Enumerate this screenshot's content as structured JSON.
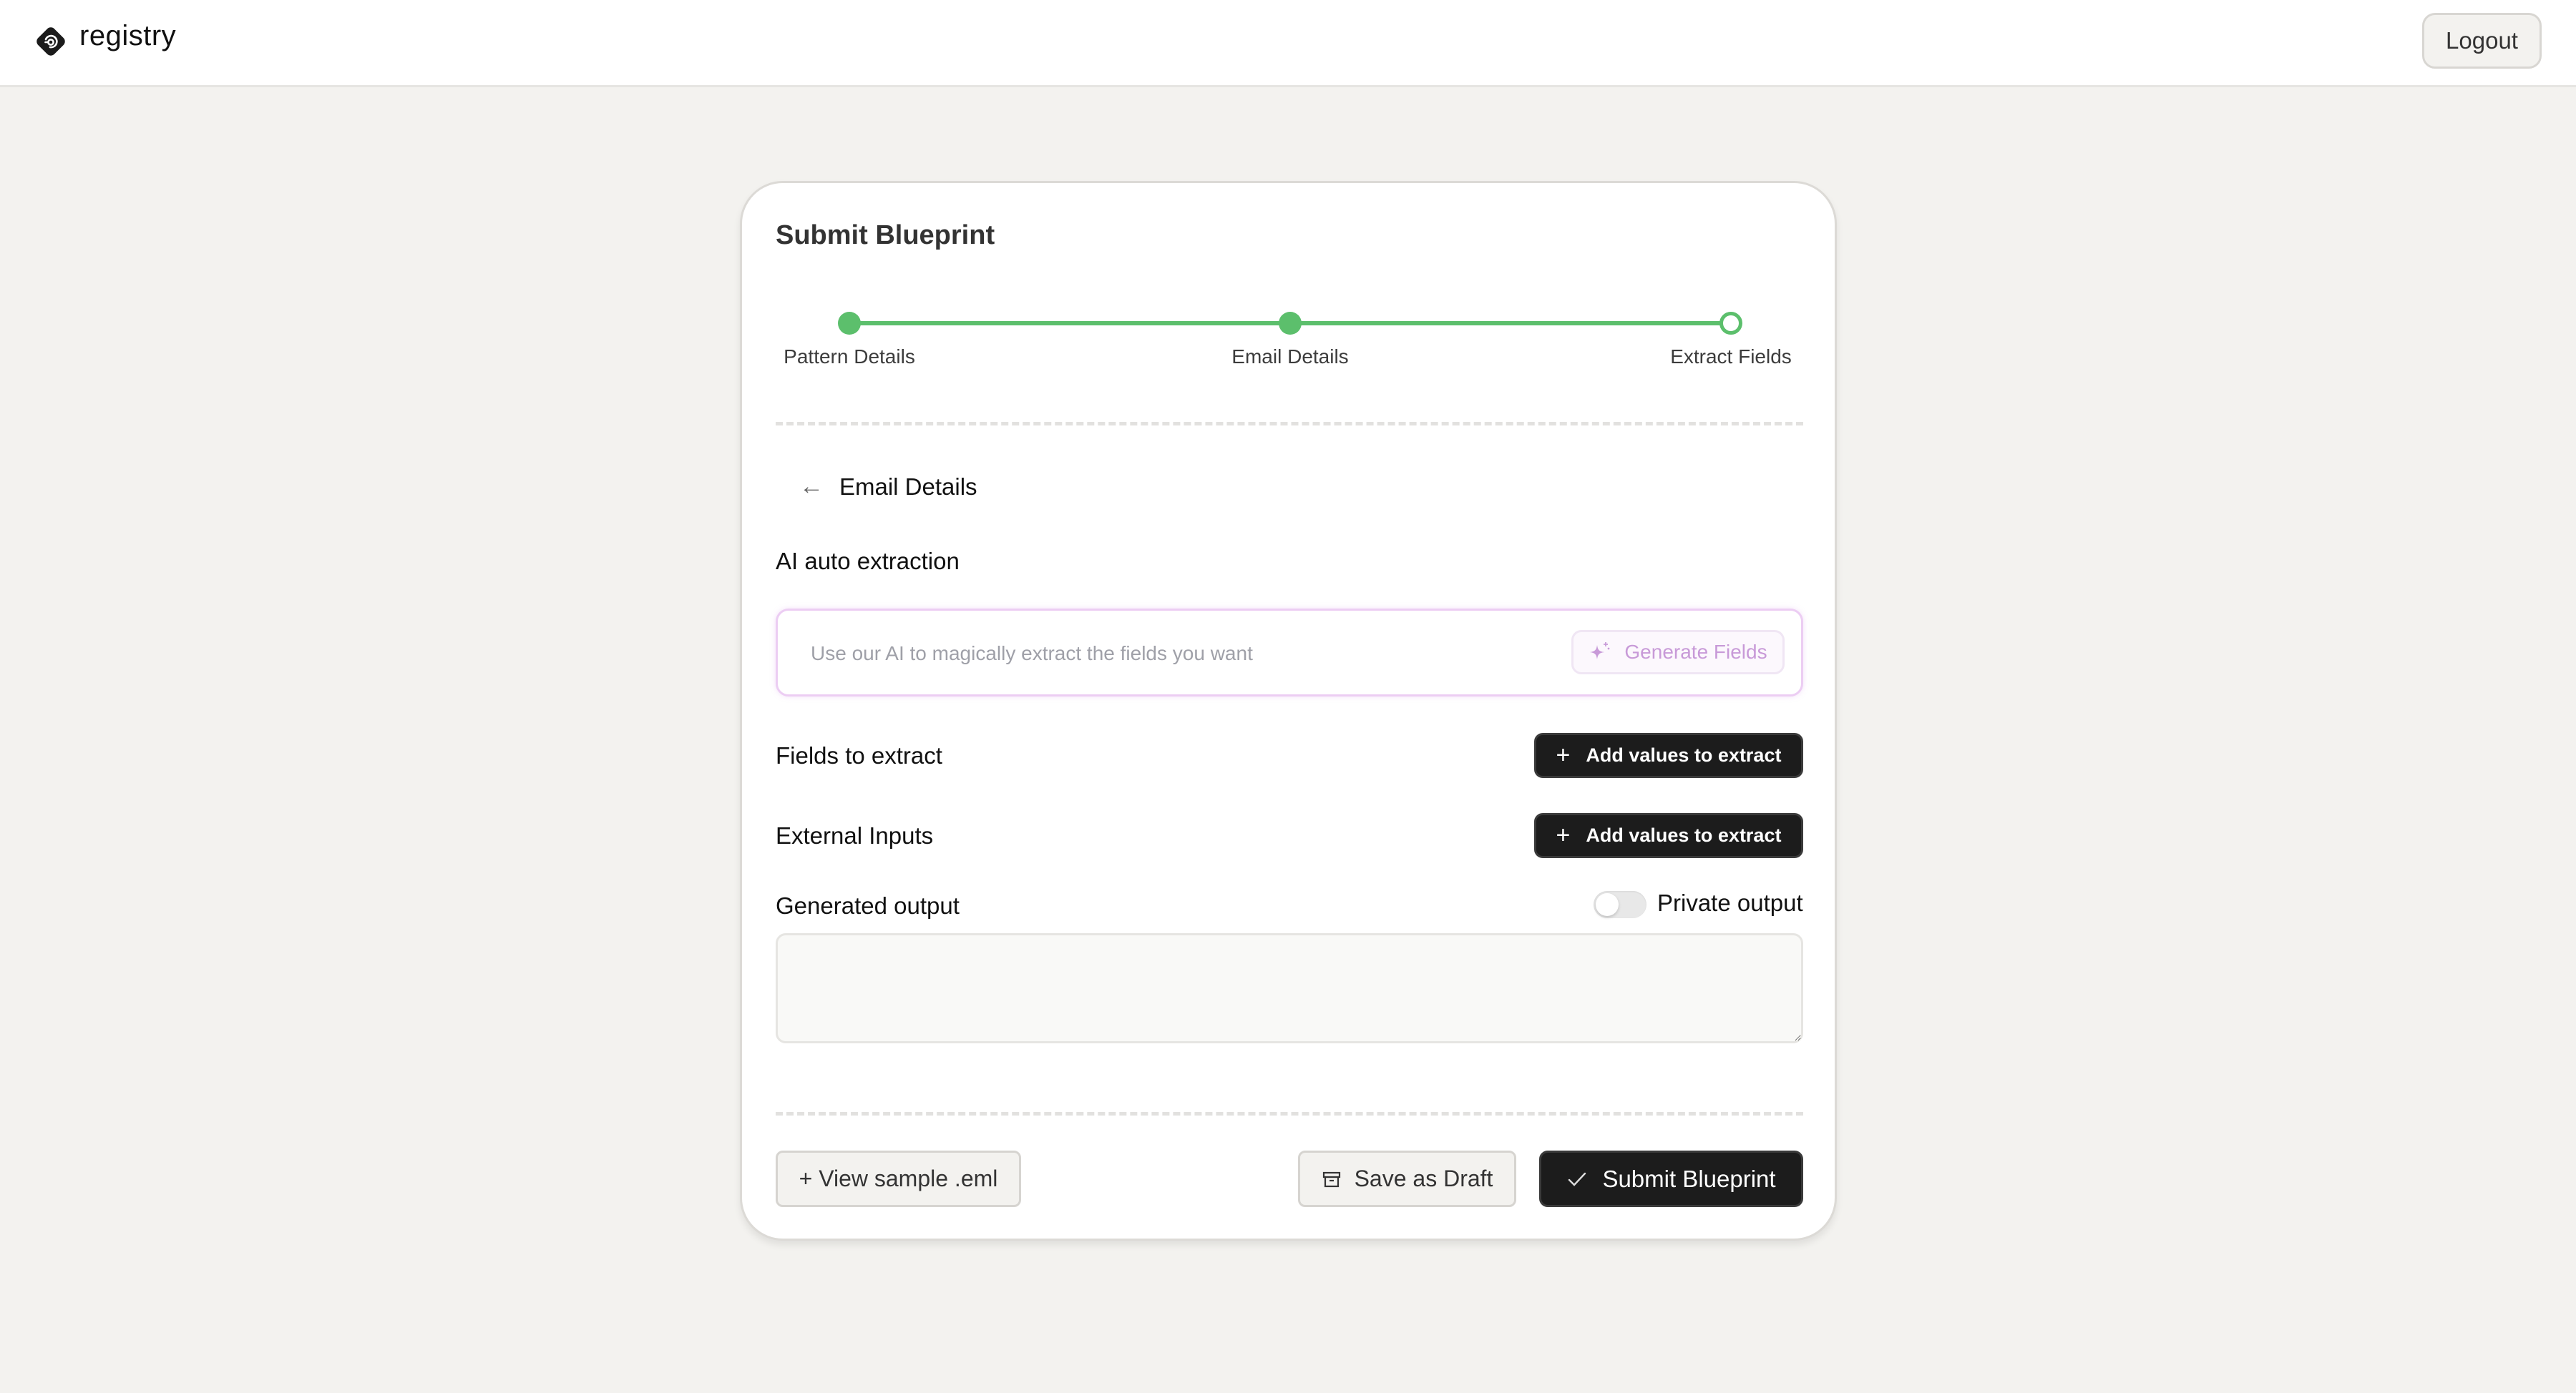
{
  "header": {
    "brand": "registry",
    "logo_icon": "registry-logo-icon",
    "logout_label": "Logout"
  },
  "card": {
    "title": "Submit Blueprint",
    "colors": {
      "accent_green": "#5cbf6c",
      "ai_purple": "#c89ad8",
      "dark_button": "#1c1c1c"
    },
    "stepper": {
      "steps": [
        {
          "label": "Pattern Details",
          "state": "complete"
        },
        {
          "label": "Email Details",
          "state": "complete"
        },
        {
          "label": "Extract Fields",
          "state": "current"
        }
      ]
    },
    "back_link": {
      "icon": "arrow-left-icon",
      "label": "Email Details"
    },
    "ai_section": {
      "label": "AI auto extraction",
      "input_value": "",
      "input_placeholder": "Use our AI to magically extract the fields you want",
      "generate_button": {
        "icon": "sparkle-icon",
        "label": "Generate Fields"
      }
    },
    "fields_to_extract": {
      "label": "Fields to extract",
      "button": {
        "icon": "plus-icon",
        "label": "Add values to extract"
      }
    },
    "external_inputs": {
      "label": "External Inputs",
      "button": {
        "icon": "plus-icon",
        "label": "Add values to extract"
      }
    },
    "generated_output": {
      "label": "Generated output",
      "private_toggle": {
        "label": "Private output",
        "checked": false
      },
      "value": ""
    },
    "footer": {
      "view_sample_label": "+ View sample .eml",
      "save_draft": {
        "icon": "archive-icon",
        "label": "Save as Draft"
      },
      "submit": {
        "icon": "check-icon",
        "label": "Submit Blueprint"
      }
    }
  }
}
